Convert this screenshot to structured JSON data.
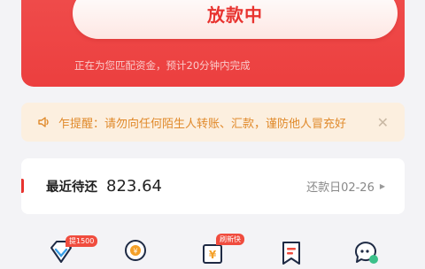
{
  "loan_status": {
    "button_label": "放款中",
    "subtitle": "正在为您匹配资金，预计20分钟内完成"
  },
  "notice": {
    "icon": "speaker-icon",
    "text": "乍提醒：请勿向任何陌生人转账、汇款，谨防他人冒充好",
    "close_icon": "close-icon"
  },
  "repayment": {
    "label": "最近待还",
    "amount": "823.64",
    "due_text": "还款日02-26"
  },
  "quick_icons": [
    {
      "icon": "diamond-icon",
      "badge": "提1500"
    },
    {
      "icon": "coin-badge-icon",
      "badge": ""
    },
    {
      "icon": "yuan-bill-icon",
      "badge": "刷新快"
    },
    {
      "icon": "bookmark-icon",
      "badge": ""
    },
    {
      "icon": "chat-icon",
      "badge": ""
    }
  ],
  "colors": {
    "primary_red": "#ec3f3f",
    "notice_bg": "#fcefdf",
    "notice_text": "#e0892a"
  }
}
